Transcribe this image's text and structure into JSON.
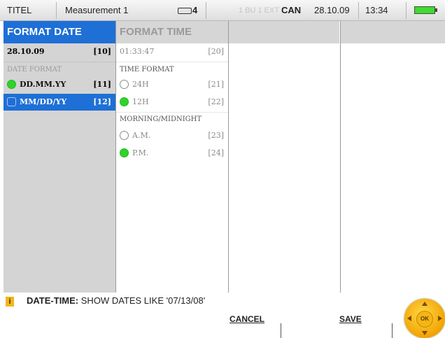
{
  "status_bar": {
    "title": "TITEL",
    "measurement": "Measurement 1",
    "device_count": "4",
    "can_faint": "1 BU 1 EXT",
    "can": "CAN",
    "date": "28.10.09",
    "time": "13:34",
    "battery_icon": "battery-full-icon",
    "battery_color": "#3ddc2e"
  },
  "columns": {
    "format_date": {
      "header": "FORMAT DATE",
      "current_value": "28.10.09",
      "current_index": "[10]",
      "caption": "DATE FORMAT",
      "options": [
        {
          "label": "DD.MM.YY",
          "index": "[11]",
          "state": "on"
        },
        {
          "label": "MM/DD/YY",
          "index": "[12]",
          "state": "selected"
        }
      ]
    },
    "format_time": {
      "header": "FORMAT TIME",
      "current_value": "01:33:47",
      "current_index": "[20]",
      "time_caption": "TIME FORMAT",
      "time_options": [
        {
          "label": "24H",
          "index": "[21]",
          "state": "off"
        },
        {
          "label": "12H",
          "index": "[22]",
          "state": "on"
        }
      ],
      "midnight_caption": "MORNING/MIDNIGHT",
      "midnight_options": [
        {
          "label": "A.M.",
          "index": "[23]",
          "state": "off"
        },
        {
          "label": "P.M.",
          "index": "[24]",
          "state": "on"
        }
      ]
    }
  },
  "info": {
    "icon": "info-icon",
    "key": "DATE-TIME:",
    "text": "SHOW DATES LIKE '07/13/08'"
  },
  "softkeys": {
    "cancel": "CANCEL",
    "save": "SAVE",
    "ok": "OK"
  },
  "colors": {
    "accent": "#1e6fd6",
    "active_dot": "#2fd42a",
    "ok_button": "#f2a300"
  }
}
